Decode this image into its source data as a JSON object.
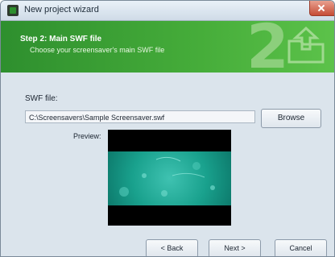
{
  "window": {
    "title": "New project wizard"
  },
  "banner": {
    "step_title": "Step 2: Main SWF file",
    "step_subtitle": "Choose your screensaver's main SWF file",
    "step_number": "2"
  },
  "form": {
    "swf_label": "SWF file:",
    "swf_path": "C:\\Screensavers\\Sample Screensaver.swf",
    "browse_label": "Browse",
    "preview_label": "Preview:"
  },
  "footer": {
    "back_label": "< Back",
    "next_label": "Next >",
    "cancel_label": "Cancel"
  },
  "colors": {
    "banner_green": "#46ad3a",
    "preview_teal": "#1aa38f"
  },
  "icons": [
    "app-icon",
    "close-icon",
    "folder-upload-icon"
  ]
}
